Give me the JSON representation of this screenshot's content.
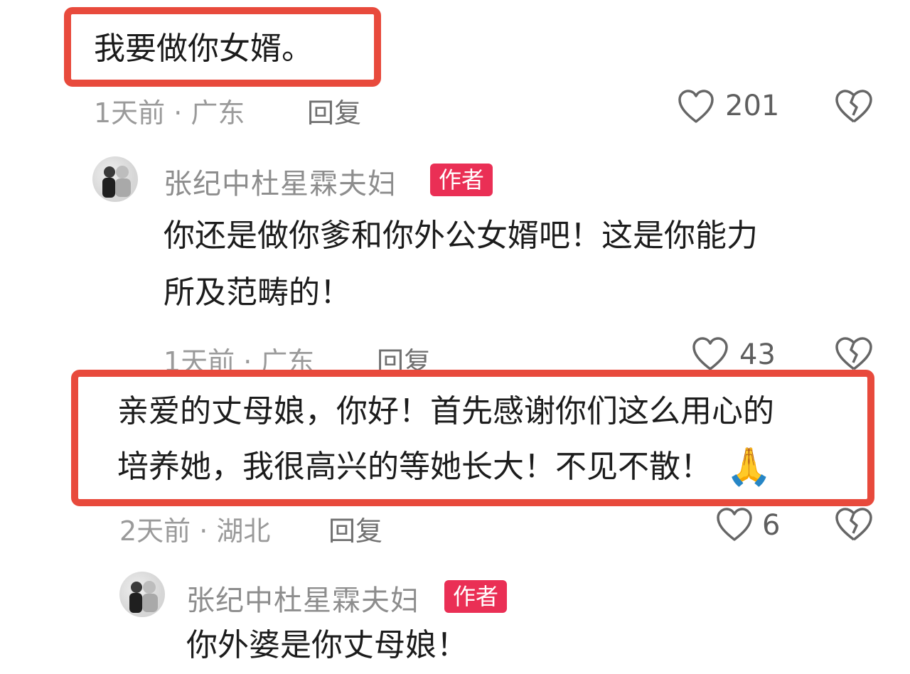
{
  "comments": [
    {
      "text": "我要做你女婿。",
      "time_loc": "1天前 · 广东",
      "reply_label": "回复",
      "likes": "201"
    },
    {
      "author": "张纪中杜星霖夫妇",
      "badge": "作者",
      "text_line1": "你还是做你爹和你外公女婿吧！这是你能力",
      "text_line2": "所及范畴的！",
      "time_loc": "1天前 · 广东",
      "reply_label": "回复",
      "likes": "43"
    },
    {
      "text_line1": "亲爱的丈母娘，你好！首先感谢你们这么用心的",
      "text_line2": "培养她，我很高兴的等她长大！不见不散！",
      "emoji": "🙏",
      "time_loc": "2天前 · 湖北",
      "reply_label": "回复",
      "likes": "6"
    },
    {
      "author": "张纪中杜星霖夫妇",
      "badge": "作者",
      "text_line1": "你外婆是你丈母娘！"
    }
  ],
  "colors": {
    "highlight_border": "#e84a3c",
    "badge_bg": "#ea2f55"
  },
  "icons": {
    "like": "heart-outline-icon",
    "dislike": "broken-heart-icon"
  }
}
